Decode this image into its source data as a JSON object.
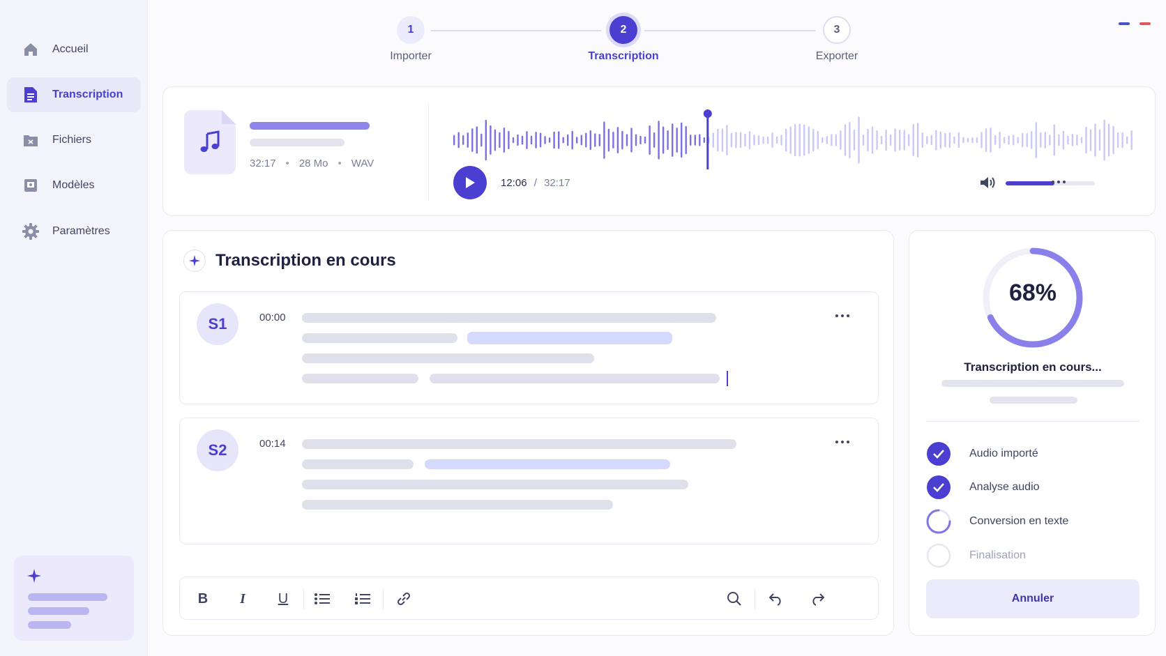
{
  "sidebar": {
    "items": [
      {
        "label": "Accueil",
        "icon": "home-icon"
      },
      {
        "label": "Transcription",
        "icon": "document-icon",
        "active": true
      },
      {
        "label": "Fichiers",
        "icon": "folder-icon"
      },
      {
        "label": "Modèles",
        "icon": "template-icon"
      },
      {
        "label": "Paramètres",
        "icon": "gear-icon"
      }
    ]
  },
  "stepper": {
    "steps": [
      {
        "number": "1",
        "label": "Importer",
        "state": "done"
      },
      {
        "number": "2",
        "label": "Transcription",
        "state": "current"
      },
      {
        "number": "3",
        "label": "Exporter",
        "state": "todo"
      }
    ]
  },
  "player": {
    "duration": "32:17",
    "size": "28 Mo",
    "format": "WAV",
    "current_time": "12:06",
    "separator": "/",
    "total_time": "32:17",
    "progress": 0.374,
    "volume": 0.55
  },
  "main": {
    "title": "Transcription en cours",
    "segments": [
      {
        "speaker": "S1",
        "timestamp": "00:00"
      },
      {
        "speaker": "S2",
        "timestamp": "00:14"
      }
    ]
  },
  "status": {
    "percent": "68%",
    "progress_value": 0.68,
    "title": "Transcription en cours...",
    "tasks": [
      {
        "label": "Audio importé",
        "state": "done"
      },
      {
        "label": "Analyse audio",
        "state": "done"
      },
      {
        "label": "Conversion en texte",
        "state": "in-progress"
      },
      {
        "label": "Finalisation",
        "state": "pending"
      }
    ],
    "cancel_label": "Annuler"
  },
  "colors": {
    "accent": "#4a3fd0",
    "accent_light": "#ebe9fb",
    "flag_blue": "#4a52c8",
    "flag_red": "#e0575e"
  }
}
